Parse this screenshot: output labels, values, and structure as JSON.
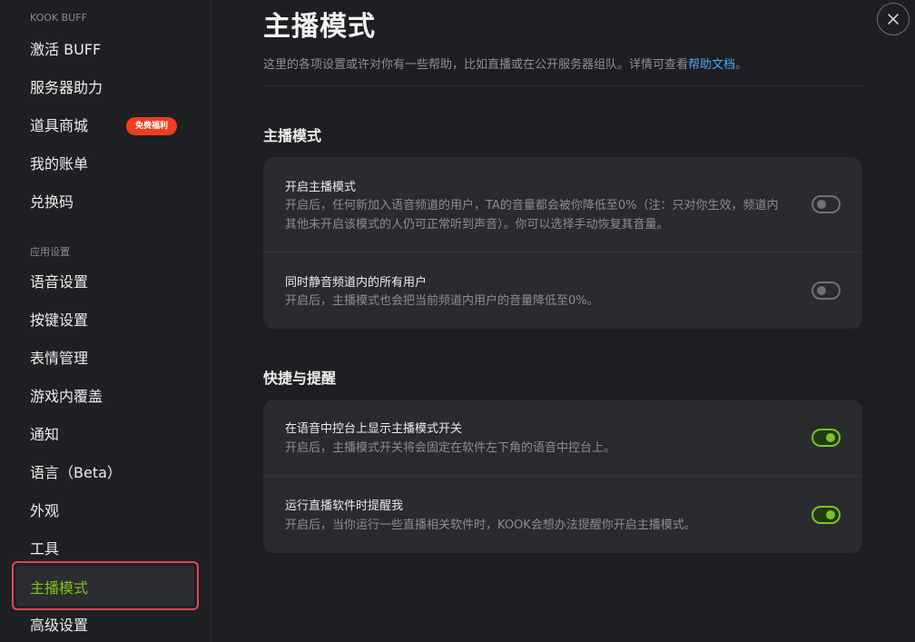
{
  "sidebar": {
    "groups": [
      {
        "label": "KOOK BUFF",
        "items": [
          {
            "label": "激活 BUFF"
          },
          {
            "label": "服务器助力"
          },
          {
            "label": "道具商城",
            "badge": "免费福利"
          },
          {
            "label": "我的账单"
          },
          {
            "label": "兑换码"
          }
        ]
      },
      {
        "label": "应用设置",
        "items": [
          {
            "label": "语音设置"
          },
          {
            "label": "按键设置"
          },
          {
            "label": "表情管理"
          },
          {
            "label": "游戏内覆盖"
          },
          {
            "label": "通知"
          },
          {
            "label": "语言（Beta）"
          },
          {
            "label": "外观"
          },
          {
            "label": "工具"
          },
          {
            "label": "主播模式",
            "active": true
          },
          {
            "label": "高级设置"
          }
        ]
      }
    ]
  },
  "header": {
    "title": "主播模式",
    "description": "这里的各项设置或许对你有一些帮助，比如直播或在公开服务器组队。详情可查看",
    "link": "帮助文档",
    "suffix": "。"
  },
  "sections": [
    {
      "title": "主播模式",
      "rows": [
        {
          "title": "开启主播模式",
          "description": "开启后，任何新加入语音频道的用户，TA的音量都会被你降低至0%（注：只对你生效，频道内其他未开启该模式的人仍可正常听到声音）。你可以选择手动恢复其音量。",
          "enabled": false
        },
        {
          "title": "同时静音频道内的所有用户",
          "description": "开启后，主播模式也会把当前频道内用户的音量降低至0%。",
          "enabled": false
        }
      ]
    },
    {
      "title": "快捷与提醒",
      "rows": [
        {
          "title": "在语音中控台上显示主播模式开关",
          "description": "开启后，主播模式开关将会固定在软件左下角的语音中控台上。",
          "enabled": true
        },
        {
          "title": "运行直播软件时提醒我",
          "description": "开启后，当你运行一些直播相关软件时，KOOK会想办法提醒你开启主播模式。",
          "enabled": true
        }
      ]
    }
  ],
  "colors": {
    "accent": "#7dc21e",
    "badge": "#ef3d1e",
    "link": "#4ea5f5",
    "highlight_border": "#e0484f"
  }
}
